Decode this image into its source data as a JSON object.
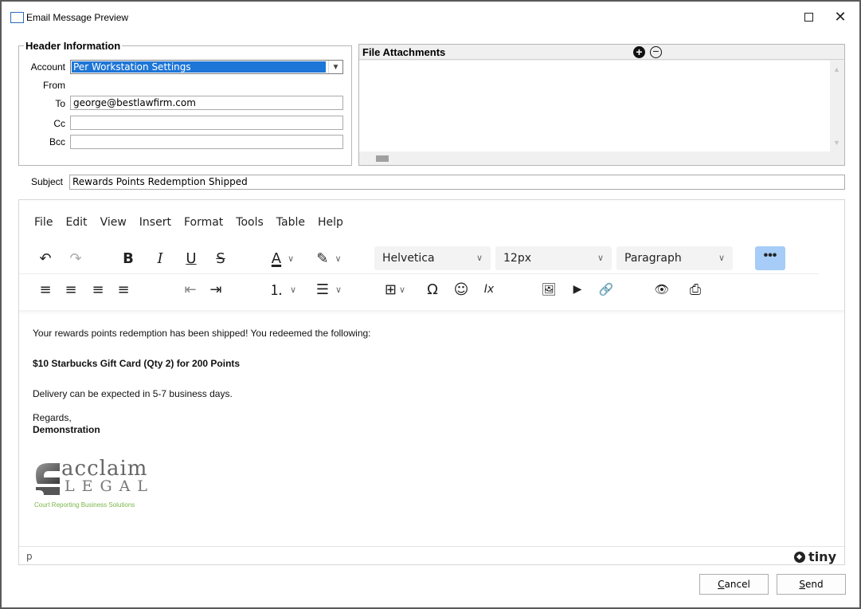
{
  "window": {
    "title": "Email Message Preview",
    "maximize_label": "☐",
    "close_label": "✕"
  },
  "header_info": {
    "group_title": "Header Information",
    "account_label": "Account",
    "account_value": "Per Workstation Settings",
    "from_label": "From",
    "to_label": "To",
    "to_value": "george@bestlawfirm.com",
    "cc_label": "Cc",
    "cc_value": "",
    "bcc_label": "Bcc",
    "bcc_value": ""
  },
  "attachments": {
    "title": "File Attachments",
    "add_label": "+",
    "remove_label": "−"
  },
  "subject": {
    "label": "Subject",
    "value": "Rewards Points Redemption Shipped"
  },
  "editor": {
    "menus": [
      "File",
      "Edit",
      "View",
      "Insert",
      "Format",
      "Tools",
      "Table",
      "Help"
    ],
    "font_family": "Helvetica",
    "font_size": "12px",
    "block_format": "Paragraph",
    "more_label": "•••",
    "icons": {
      "undo": "↶",
      "redo": "↷",
      "bold": "B",
      "italic": "I",
      "underline": "U",
      "strikethrough": "S",
      "text_color": "A",
      "highlight": "✎",
      "chevron": "∨",
      "align_left": "≡",
      "align_center": "≡",
      "align_right": "≡",
      "justify": "≡",
      "outdent": "⇤",
      "indent": "⇥",
      "numbered_list": "⒈",
      "bullet_list": "☰",
      "table": "⊞",
      "special_char": "Ω",
      "emoticons": "☺",
      "clear_format": "Ix",
      "image": "🖼",
      "media": "▶",
      "link": "🔗",
      "preview": "👁",
      "print": "⎙"
    },
    "content": {
      "line1": "Your rewards points redemption has been shipped! You redeemed the following:",
      "line2": "$10 Starbucks Gift Card (Qty 2) for 200 Points",
      "line3": "Delivery can be expected in 5-7 business days.",
      "regards": "Regards,",
      "signature": "Demonstration"
    },
    "logo": {
      "word1": "acclaim",
      "word2": "LEGAL",
      "tagline": "Court Reporting Business Solutions",
      "tagline_color": "#7ab648"
    },
    "status_path": "p",
    "brand": "tiny"
  },
  "buttons": {
    "cancel": "Cancel",
    "send": "Send"
  }
}
